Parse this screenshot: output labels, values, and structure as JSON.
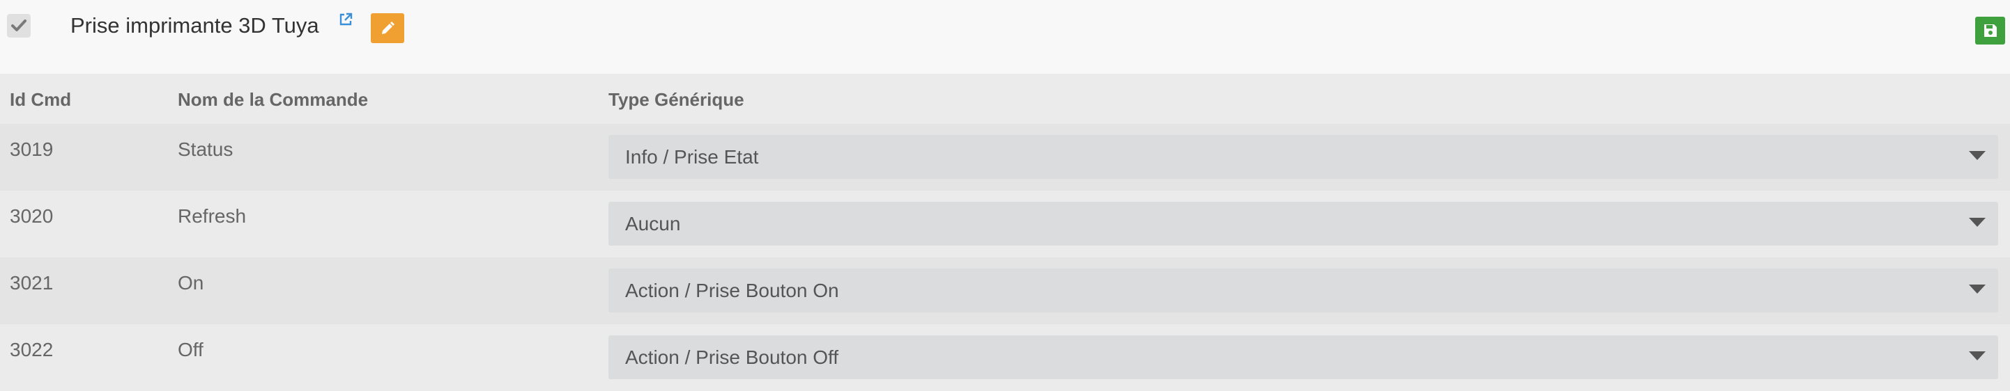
{
  "header": {
    "title": "Prise imprimante 3D Tuya",
    "checked": true,
    "icons": {
      "checkbox": "check-icon",
      "external": "external-link-icon",
      "edit": "pencil-icon",
      "save": "floppy-icon"
    },
    "colors": {
      "edit": "#f0a030",
      "save": "#3ea13e",
      "link": "#3a8fd8"
    }
  },
  "table": {
    "headers": [
      "Id Cmd",
      "Nom de la Commande",
      "Type Générique"
    ],
    "rows": [
      {
        "id": "3019",
        "name": "Status",
        "type": "Info / Prise Etat"
      },
      {
        "id": "3020",
        "name": "Refresh",
        "type": "Aucun"
      },
      {
        "id": "3021",
        "name": "On",
        "type": "Action / Prise Bouton On"
      },
      {
        "id": "3022",
        "name": "Off",
        "type": "Action / Prise Bouton Off"
      }
    ]
  }
}
